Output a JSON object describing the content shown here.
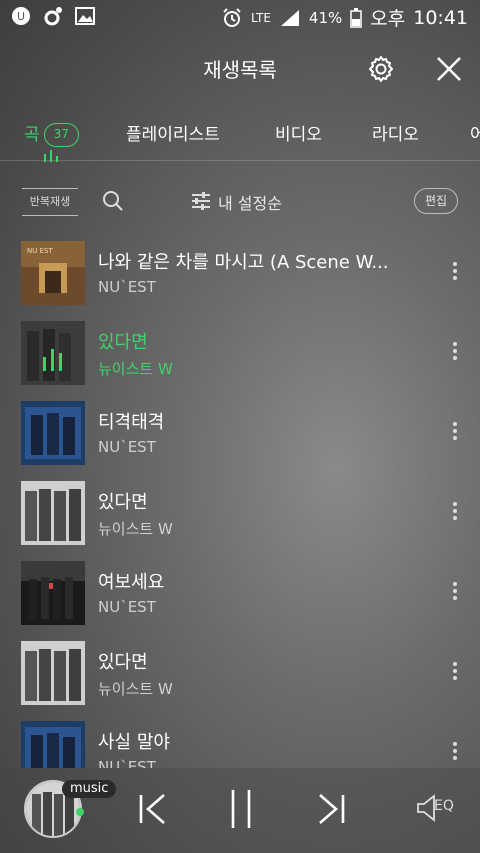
{
  "status": {
    "battery": "41%",
    "ampm": "오후",
    "time": "10:41",
    "network": "LTE"
  },
  "header": {
    "title": "재생목록"
  },
  "tabs": [
    {
      "label": "곡",
      "badge": "37",
      "active": true
    },
    {
      "label": "플레이리스트"
    },
    {
      "label": "비디오"
    },
    {
      "label": "라디오"
    },
    {
      "label": "어"
    }
  ],
  "controls": {
    "repeat": "반복재생",
    "sort": "내 설정순",
    "edit": "편집"
  },
  "songs": [
    {
      "title": "나와 같은 차를 마시고 (A Scene W...",
      "artist": "NU`EST",
      "playing": false
    },
    {
      "title": "있다면",
      "artist": "뉴이스트 W",
      "playing": true
    },
    {
      "title": "티격태격",
      "artist": "NU`EST",
      "playing": false
    },
    {
      "title": "있다면",
      "artist": "뉴이스트 W",
      "playing": false
    },
    {
      "title": "여보세요",
      "artist": "NU`EST",
      "playing": false
    },
    {
      "title": "있다면",
      "artist": "뉴이스트 W",
      "playing": false
    },
    {
      "title": "사실 말야",
      "artist": "NU`EST",
      "playing": false
    }
  ],
  "player": {
    "label": "music",
    "eq": "EQ"
  },
  "colors": {
    "accent": "#3fd46b"
  }
}
